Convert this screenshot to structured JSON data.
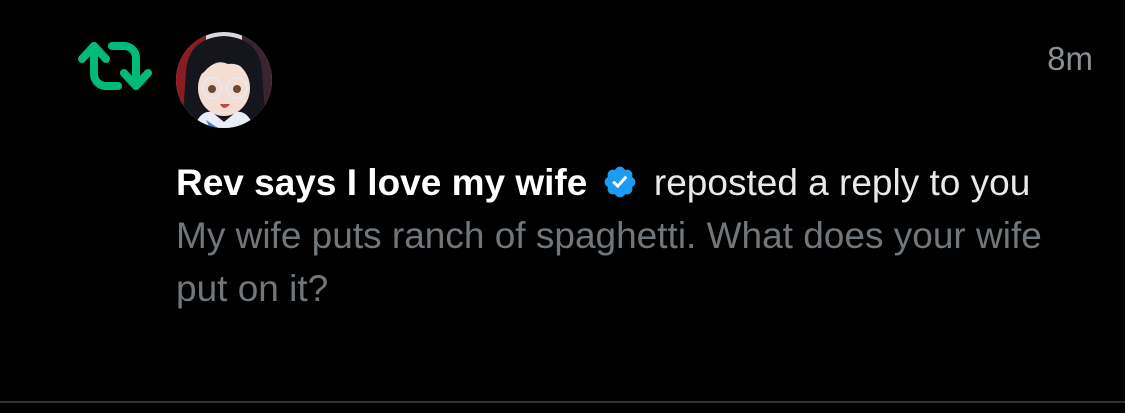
{
  "notification": {
    "timestamp": "8m",
    "author": "Rev says I love my wife",
    "action_text": "reposted a reply to you",
    "reply_text": "My wife puts ranch of spaghetti. What does your wife put on it?"
  },
  "icons": {
    "repost": "repost-icon",
    "verified": "verified-badge-icon",
    "avatar": "anime-girl-avatar"
  },
  "colors": {
    "repost_green": "#00ba7c",
    "verified_blue": "#1d9bf0",
    "background": "#000000",
    "secondary_text": "#71767b"
  }
}
